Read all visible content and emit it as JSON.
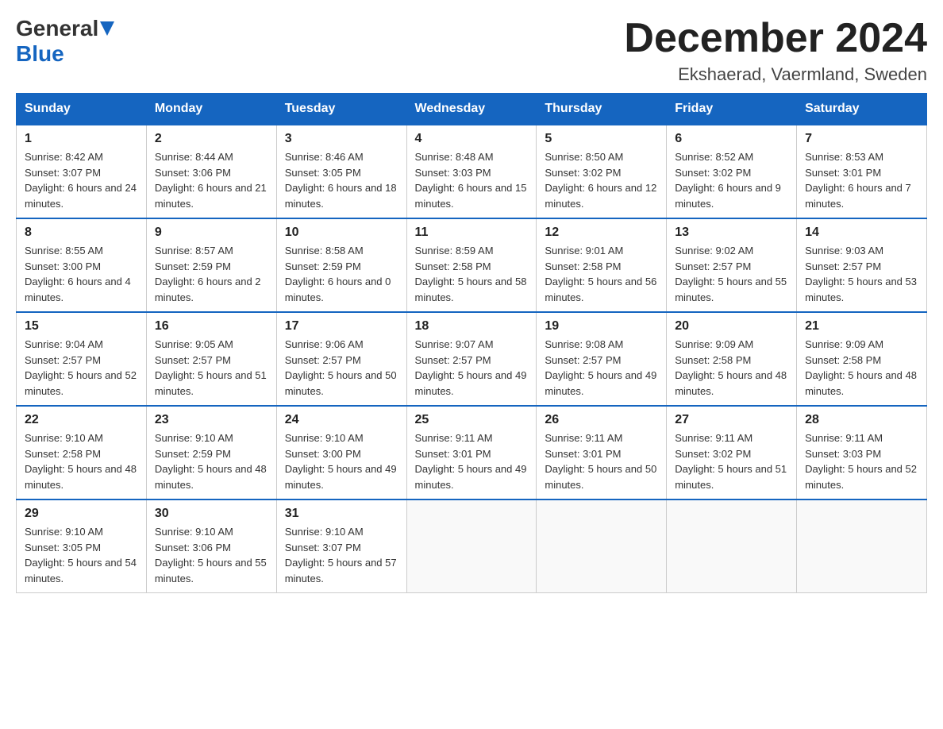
{
  "header": {
    "logo_general": "General",
    "logo_blue": "Blue",
    "month_title": "December 2024",
    "location": "Ekshaerad, Vaermland, Sweden"
  },
  "days_of_week": [
    "Sunday",
    "Monday",
    "Tuesday",
    "Wednesday",
    "Thursday",
    "Friday",
    "Saturday"
  ],
  "weeks": [
    [
      {
        "day": "1",
        "sunrise": "8:42 AM",
        "sunset": "3:07 PM",
        "daylight": "6 hours and 24 minutes."
      },
      {
        "day": "2",
        "sunrise": "8:44 AM",
        "sunset": "3:06 PM",
        "daylight": "6 hours and 21 minutes."
      },
      {
        "day": "3",
        "sunrise": "8:46 AM",
        "sunset": "3:05 PM",
        "daylight": "6 hours and 18 minutes."
      },
      {
        "day": "4",
        "sunrise": "8:48 AM",
        "sunset": "3:03 PM",
        "daylight": "6 hours and 15 minutes."
      },
      {
        "day": "5",
        "sunrise": "8:50 AM",
        "sunset": "3:02 PM",
        "daylight": "6 hours and 12 minutes."
      },
      {
        "day": "6",
        "sunrise": "8:52 AM",
        "sunset": "3:02 PM",
        "daylight": "6 hours and 9 minutes."
      },
      {
        "day": "7",
        "sunrise": "8:53 AM",
        "sunset": "3:01 PM",
        "daylight": "6 hours and 7 minutes."
      }
    ],
    [
      {
        "day": "8",
        "sunrise": "8:55 AM",
        "sunset": "3:00 PM",
        "daylight": "6 hours and 4 minutes."
      },
      {
        "day": "9",
        "sunrise": "8:57 AM",
        "sunset": "2:59 PM",
        "daylight": "6 hours and 2 minutes."
      },
      {
        "day": "10",
        "sunrise": "8:58 AM",
        "sunset": "2:59 PM",
        "daylight": "6 hours and 0 minutes."
      },
      {
        "day": "11",
        "sunrise": "8:59 AM",
        "sunset": "2:58 PM",
        "daylight": "5 hours and 58 minutes."
      },
      {
        "day": "12",
        "sunrise": "9:01 AM",
        "sunset": "2:58 PM",
        "daylight": "5 hours and 56 minutes."
      },
      {
        "day": "13",
        "sunrise": "9:02 AM",
        "sunset": "2:57 PM",
        "daylight": "5 hours and 55 minutes."
      },
      {
        "day": "14",
        "sunrise": "9:03 AM",
        "sunset": "2:57 PM",
        "daylight": "5 hours and 53 minutes."
      }
    ],
    [
      {
        "day": "15",
        "sunrise": "9:04 AM",
        "sunset": "2:57 PM",
        "daylight": "5 hours and 52 minutes."
      },
      {
        "day": "16",
        "sunrise": "9:05 AM",
        "sunset": "2:57 PM",
        "daylight": "5 hours and 51 minutes."
      },
      {
        "day": "17",
        "sunrise": "9:06 AM",
        "sunset": "2:57 PM",
        "daylight": "5 hours and 50 minutes."
      },
      {
        "day": "18",
        "sunrise": "9:07 AM",
        "sunset": "2:57 PM",
        "daylight": "5 hours and 49 minutes."
      },
      {
        "day": "19",
        "sunrise": "9:08 AM",
        "sunset": "2:57 PM",
        "daylight": "5 hours and 49 minutes."
      },
      {
        "day": "20",
        "sunrise": "9:09 AM",
        "sunset": "2:58 PM",
        "daylight": "5 hours and 48 minutes."
      },
      {
        "day": "21",
        "sunrise": "9:09 AM",
        "sunset": "2:58 PM",
        "daylight": "5 hours and 48 minutes."
      }
    ],
    [
      {
        "day": "22",
        "sunrise": "9:10 AM",
        "sunset": "2:58 PM",
        "daylight": "5 hours and 48 minutes."
      },
      {
        "day": "23",
        "sunrise": "9:10 AM",
        "sunset": "2:59 PM",
        "daylight": "5 hours and 48 minutes."
      },
      {
        "day": "24",
        "sunrise": "9:10 AM",
        "sunset": "3:00 PM",
        "daylight": "5 hours and 49 minutes."
      },
      {
        "day": "25",
        "sunrise": "9:11 AM",
        "sunset": "3:01 PM",
        "daylight": "5 hours and 49 minutes."
      },
      {
        "day": "26",
        "sunrise": "9:11 AM",
        "sunset": "3:01 PM",
        "daylight": "5 hours and 50 minutes."
      },
      {
        "day": "27",
        "sunrise": "9:11 AM",
        "sunset": "3:02 PM",
        "daylight": "5 hours and 51 minutes."
      },
      {
        "day": "28",
        "sunrise": "9:11 AM",
        "sunset": "3:03 PM",
        "daylight": "5 hours and 52 minutes."
      }
    ],
    [
      {
        "day": "29",
        "sunrise": "9:10 AM",
        "sunset": "3:05 PM",
        "daylight": "5 hours and 54 minutes."
      },
      {
        "day": "30",
        "sunrise": "9:10 AM",
        "sunset": "3:06 PM",
        "daylight": "5 hours and 55 minutes."
      },
      {
        "day": "31",
        "sunrise": "9:10 AM",
        "sunset": "3:07 PM",
        "daylight": "5 hours and 57 minutes."
      },
      null,
      null,
      null,
      null
    ]
  ],
  "labels": {
    "sunrise": "Sunrise:",
    "sunset": "Sunset:",
    "daylight": "Daylight:"
  }
}
